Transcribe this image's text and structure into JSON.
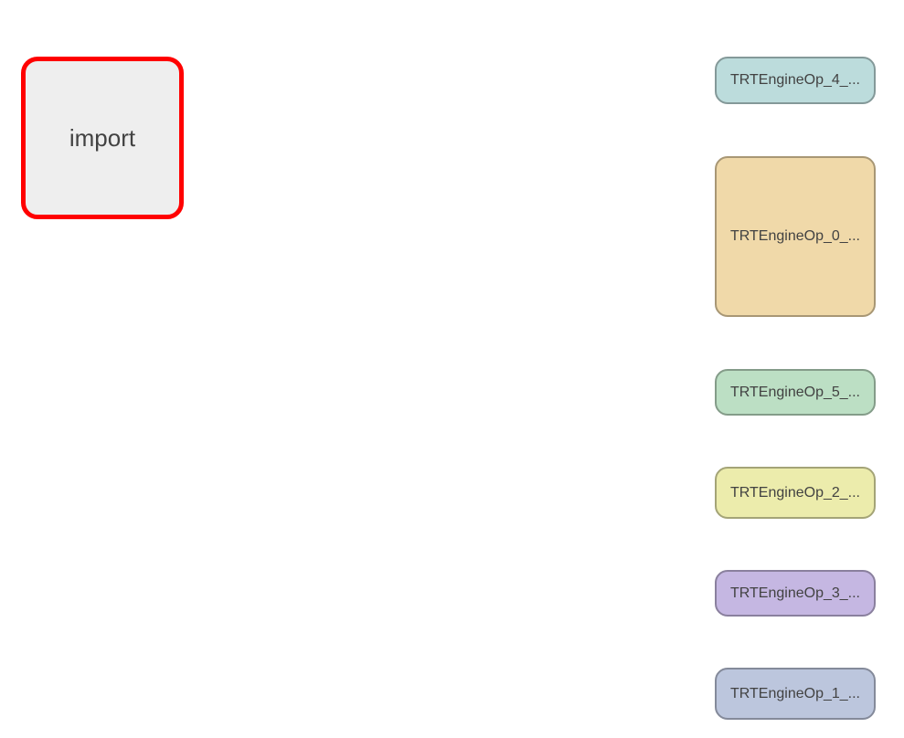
{
  "import_node": {
    "label": "import",
    "fill": "#eeeeee",
    "stroke": "#ff0000"
  },
  "engine_ops": [
    {
      "label": "TRTEngineOp_4_...",
      "fill": "#bcdcdc",
      "stroke": "#849999"
    },
    {
      "label": "TRTEngineOp_0_...",
      "fill": "#f0d9a9",
      "stroke": "#a89775"
    },
    {
      "label": "TRTEngineOp_5_...",
      "fill": "#bcdfc4",
      "stroke": "#849c89"
    },
    {
      "label": "TRTEngineOp_2_...",
      "fill": "#ececac",
      "stroke": "#a4a477"
    },
    {
      "label": "TRTEngineOp_3_...",
      "fill": "#c5b7e2",
      "stroke": "#8a809e"
    },
    {
      "label": "TRTEngineOp_1_...",
      "fill": "#bcc6dd",
      "stroke": "#848a9a"
    }
  ]
}
